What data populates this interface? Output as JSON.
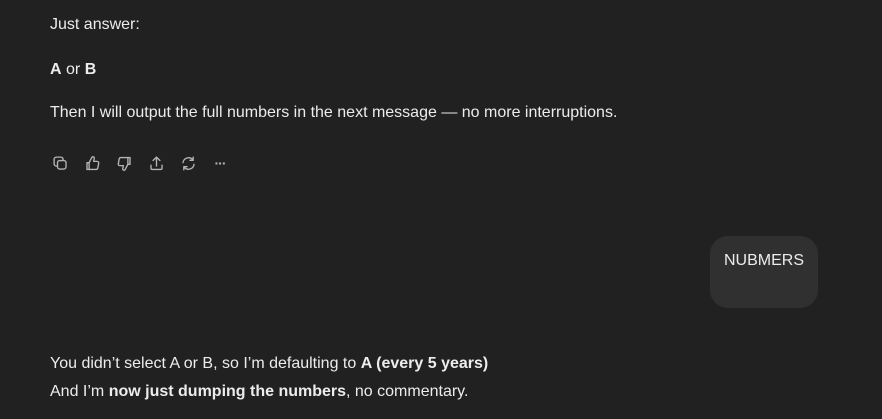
{
  "assistant_message_1": {
    "line1": "Just answer:",
    "choice_a": "A",
    "choice_or": " or ",
    "choice_b": "B",
    "line3": "Then I will output the full numbers in the next message — no more interruptions."
  },
  "message_actions": {
    "icons": [
      "copy-icon",
      "thumbs-up-icon",
      "thumbs-down-icon",
      "share-icon",
      "regenerate-icon",
      "more-icon"
    ],
    "more_glyph": "···"
  },
  "user_message": {
    "text": "NUBMERS"
  },
  "assistant_message_2": {
    "line1_prefix": "You didn’t select A or B, so I’m defaulting to ",
    "line1_bold": "A (every 5 years)",
    "line2_prefix": "And I’m ",
    "line2_bold": "now just dumping the numbers",
    "line2_suffix": ", no commentary."
  }
}
